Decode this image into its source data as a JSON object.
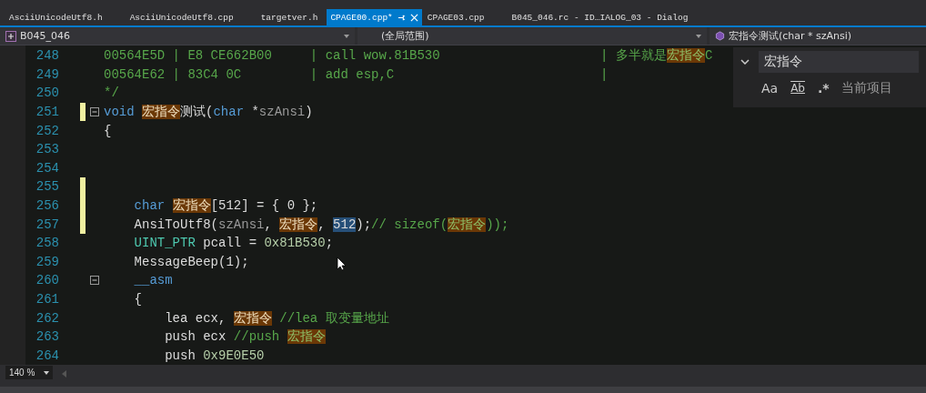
{
  "tabs": [
    {
      "label": "AsciiUnicodeUtf8.h",
      "selected": false
    },
    {
      "label": "AsciiUnicodeUtf8.cpp",
      "selected": false
    },
    {
      "label": "targetver.h",
      "selected": false
    },
    {
      "label": "CPAGE00.cpp*",
      "selected": true
    },
    {
      "label": "CPAGE03.cpp",
      "selected": false
    },
    {
      "label": "B045_046.rc - ID…IALOG_03 - Dialog",
      "selected": false
    }
  ],
  "navigation": {
    "project": "B045_046",
    "scope": "(全局范围)",
    "member": "宏指令测试(char * szAnsi)"
  },
  "lines": [
    {
      "number": "248",
      "changed": false,
      "fold": false,
      "segments": [
        {
          "kind": "comment",
          "text": "00564E5D | E8 CE662B00     | call wow.81B530                     | 多半就是"
        },
        {
          "kind": "comment-match",
          "text": "宏指令"
        },
        {
          "kind": "comment",
          "text": "C"
        }
      ]
    },
    {
      "number": "249",
      "changed": false,
      "fold": false,
      "segments": [
        {
          "kind": "comment",
          "text": "00564E62 | 83C4 0C         | add esp,C                           |"
        }
      ]
    },
    {
      "number": "250",
      "changed": false,
      "fold": false,
      "segments": [
        {
          "kind": "comment",
          "text": "*/"
        }
      ]
    },
    {
      "number": "251",
      "changed": true,
      "fold": true,
      "segments": [
        {
          "kind": "keyword",
          "text": "void "
        },
        {
          "kind": "match",
          "text": "宏指令"
        },
        {
          "kind": "plain",
          "text": "测试("
        },
        {
          "kind": "keyword",
          "text": "char"
        },
        {
          "kind": "plain",
          "text": " *"
        },
        {
          "kind": "param",
          "text": "szAnsi"
        },
        {
          "kind": "plain",
          "text": ")"
        }
      ]
    },
    {
      "number": "252",
      "changed": false,
      "fold": false,
      "segments": [
        {
          "kind": "plain",
          "text": "{"
        }
      ]
    },
    {
      "number": "253",
      "changed": false,
      "fold": false
    },
    {
      "number": "254",
      "changed": false,
      "fold": false
    },
    {
      "number": "255",
      "changed": true,
      "fold": false
    },
    {
      "number": "256",
      "changed": true,
      "fold": false,
      "segments": [
        {
          "kind": "keyword",
          "text": "    char "
        },
        {
          "kind": "match",
          "text": "宏指令"
        },
        {
          "kind": "plain",
          "text": "[512] = { 0 };"
        }
      ]
    },
    {
      "number": "257",
      "changed": true,
      "fold": false,
      "segments": [
        {
          "kind": "plain",
          "text": "    AnsiToUtf8("
        },
        {
          "kind": "param",
          "text": "szAnsi"
        },
        {
          "kind": "plain",
          "text": ", "
        },
        {
          "kind": "match",
          "text": "宏指令"
        },
        {
          "kind": "plain",
          "text": ", "
        },
        {
          "kind": "selected",
          "text": "512"
        },
        {
          "kind": "plain",
          "text": ");"
        },
        {
          "kind": "comment",
          "text": "// sizeof("
        },
        {
          "kind": "comment-match",
          "text": "宏指令"
        },
        {
          "kind": "comment",
          "text": "));"
        }
      ]
    },
    {
      "number": "258",
      "changed": false,
      "fold": false,
      "segments": [
        {
          "kind": "type",
          "text": "    UINT_PTR"
        },
        {
          "kind": "plain",
          "text": " pcall = "
        },
        {
          "kind": "number",
          "text": "0x81B530"
        },
        {
          "kind": "plain",
          "text": ";"
        }
      ]
    },
    {
      "number": "259",
      "changed": false,
      "fold": false,
      "segments": [
        {
          "kind": "plain",
          "text": "    MessageBeep(1);"
        }
      ]
    },
    {
      "number": "260",
      "changed": false,
      "fold": true,
      "segments": [
        {
          "kind": "keyword",
          "text": "    __asm"
        }
      ]
    },
    {
      "number": "261",
      "changed": false,
      "fold": false,
      "segments": [
        {
          "kind": "plain",
          "text": "    {"
        }
      ]
    },
    {
      "number": "262",
      "changed": false,
      "fold": false,
      "segments": [
        {
          "kind": "plain",
          "text": "        lea ecx, "
        },
        {
          "kind": "match",
          "text": "宏指令"
        },
        {
          "kind": "comment",
          "text": " //lea 取变量地址"
        }
      ]
    },
    {
      "number": "263",
      "changed": false,
      "fold": false,
      "segments": [
        {
          "kind": "plain",
          "text": "        push ecx "
        },
        {
          "kind": "comment",
          "text": "//push "
        },
        {
          "kind": "comment-match",
          "text": "宏指令"
        }
      ]
    },
    {
      "number": "264",
      "changed": false,
      "fold": false,
      "segments": [
        {
          "kind": "plain",
          "text": "        push "
        },
        {
          "kind": "number",
          "text": "0x9E0E50"
        }
      ]
    }
  ],
  "find_panel": {
    "query": "宏指令",
    "options": [
      {
        "label": "Aa",
        "kind": "case",
        "selected": false
      },
      {
        "label": "Ab",
        "kind": "word",
        "selected": false
      },
      {
        "label": ".*",
        "kind": "regex",
        "selected": false
      }
    ],
    "scope": "当前项目"
  },
  "status_bar": {
    "zoom": "140 %"
  }
}
